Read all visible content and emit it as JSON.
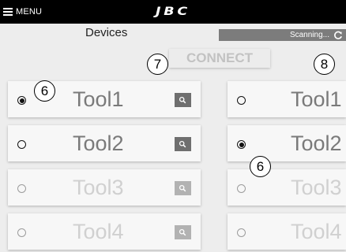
{
  "header": {
    "menu_label": "MENU",
    "logo_text": "JBC"
  },
  "devices": {
    "title": "Devices",
    "scanning_text": "Scanning...",
    "connect_label": "CONNECT"
  },
  "callouts": [
    "6",
    "7",
    "8",
    "6"
  ],
  "tools_left": [
    {
      "name": "Tool1",
      "selected": true,
      "enabled": true
    },
    {
      "name": "Tool2",
      "selected": false,
      "enabled": true
    },
    {
      "name": "Tool3",
      "selected": false,
      "enabled": false
    },
    {
      "name": "Tool4",
      "selected": false,
      "enabled": false
    }
  ],
  "tools_right": [
    {
      "name": "Tool1",
      "selected": false,
      "enabled": true
    },
    {
      "name": "Tool2",
      "selected": true,
      "enabled": true
    },
    {
      "name": "Tool3",
      "selected": false,
      "enabled": false
    },
    {
      "name": "Tool4",
      "selected": false,
      "enabled": false
    }
  ],
  "colors": {
    "topbar": "#000000",
    "background": "#ededed",
    "scanning_bar": "#7c7c7c",
    "tool_text": "#7a7a7a",
    "tool_text_disabled": "#d0d0d0",
    "connect_text": "#c2c2c2"
  }
}
